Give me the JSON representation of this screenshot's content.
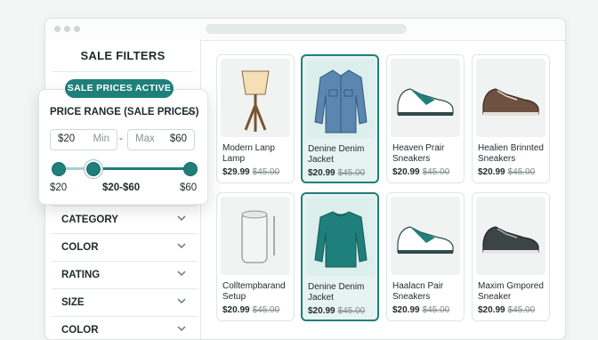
{
  "sidebar": {
    "title": "SALE FILTERS",
    "badge": "SALE PRICES ACTIVE",
    "price_range": {
      "title": "PRICE RANGE (SALE PRICES)",
      "min_value": "$20",
      "min_placeholder": "Min",
      "max_placeholder": "Max",
      "max_value": "$60",
      "separator": "-",
      "scale_min": "$20",
      "selected_label": "$20-$60",
      "scale_max": "$60"
    },
    "facets": [
      {
        "label": "CATEGORY"
      },
      {
        "label": "COLOR"
      },
      {
        "label": "RATING"
      },
      {
        "label": "SIZE"
      },
      {
        "label": "COLOR"
      }
    ]
  },
  "products": [
    {
      "name": "Modern Lanp Lamp",
      "sale_price": "$29.99",
      "original_price": "$45.00",
      "icon": "lamp-icon",
      "selected": false
    },
    {
      "name": "Denine Denim Jacket",
      "sale_price": "$20.99",
      "original_price": "$45.00",
      "icon": "denim-jacket-icon",
      "selected": true
    },
    {
      "name": "Heaven Prair Sneakers",
      "sale_price": "$20.99",
      "original_price": "$45.00",
      "icon": "teal-sneaker-icon",
      "selected": false
    },
    {
      "name": "Healien Brinnted Sneakers",
      "sale_price": "$20.99",
      "original_price": "$45.00",
      "icon": "brown-sneaker-icon",
      "selected": false
    },
    {
      "name": "Colltempbarand Setup",
      "sale_price": "$20.99",
      "original_price": "$45.00",
      "icon": "cylinder-speaker-icon",
      "selected": false
    },
    {
      "name": "Denine Denim Jacket",
      "sale_price": "$20.99",
      "original_price": "$45.00",
      "icon": "teal-sweater-icon",
      "selected": true
    },
    {
      "name": "Haalacn Pair Sneakers",
      "sale_price": "$20.99",
      "original_price": "$45.00",
      "icon": "teal-sneaker-icon",
      "selected": false
    },
    {
      "name": "Maxim Gmpored Sneaker",
      "sale_price": "$20.99",
      "original_price": "$45.00",
      "icon": "dark-sneaker-icon",
      "selected": false
    }
  ],
  "colors": {
    "accent": "#1f7f7a",
    "accent_light": "#e7f3f1"
  }
}
